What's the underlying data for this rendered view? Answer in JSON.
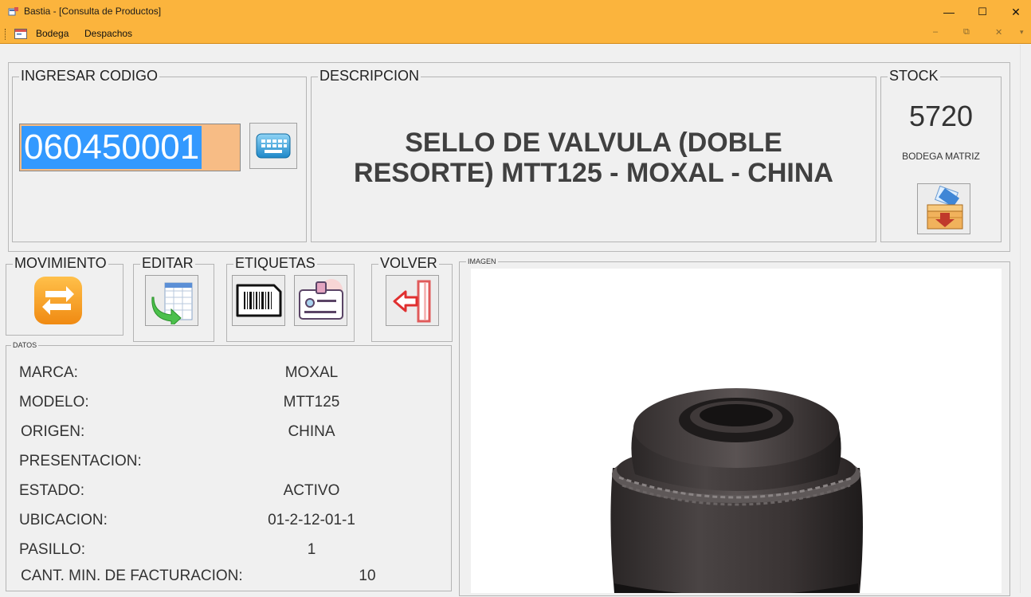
{
  "window": {
    "title": "Bastia - [Consulta de Productos]",
    "minimize_glyph": "—",
    "maximize_glyph": "☐",
    "close_glyph": "✕",
    "accent_color": "#fbb43d"
  },
  "menubar": {
    "items": [
      {
        "label": "Bodega"
      },
      {
        "label": "Despachos"
      }
    ],
    "mdi_minimize_glyph": "–",
    "mdi_restore_glyph": "⧉",
    "mdi_close_glyph": "✕",
    "mdi_arrow_glyph": "▾"
  },
  "codigo": {
    "legend": "INGRESAR CODIGO",
    "value": "060450001",
    "keyboard_icon": "keyboard-icon"
  },
  "descripcion": {
    "legend": "DESCRIPCION",
    "line1": "SELLO DE VALVULA (DOBLE",
    "line2": "RESORTE) MTT125 - MOXAL - CHINA"
  },
  "stock": {
    "legend": "STOCK",
    "value": "5720",
    "location": "BODEGA MATRIZ",
    "icon": "warehouse-box-icon"
  },
  "actions": {
    "movimiento": {
      "legend": "MOVIMIENTO",
      "icon": "swap-arrows-icon"
    },
    "editar": {
      "legend": "EDITAR",
      "icon": "edit-table-icon"
    },
    "etiquetas": {
      "legend": "ETIQUETAS",
      "icons": [
        "barcode-icon",
        "id-card-icon"
      ]
    },
    "volver": {
      "legend": "VOLVER",
      "icon": "exit-door-icon"
    }
  },
  "datos": {
    "legend": "DATOS",
    "rows": [
      {
        "label": "MARCA:",
        "value": "MOXAL"
      },
      {
        "label": "MODELO:",
        "value": "MTT125"
      },
      {
        "label": "ORIGEN:",
        "value": "CHINA"
      },
      {
        "label": "PRESENTACION:",
        "value": ""
      },
      {
        "label": "ESTADO:",
        "value": "ACTIVO"
      },
      {
        "label": "UBICACION:",
        "value": "01-2-12-01-1"
      },
      {
        "label": "PASILLO:",
        "value": "1"
      },
      {
        "label": "CANT. MIN. DE FACTURACION:",
        "value": "10"
      }
    ]
  },
  "imagen": {
    "legend": "IMAGEN"
  }
}
